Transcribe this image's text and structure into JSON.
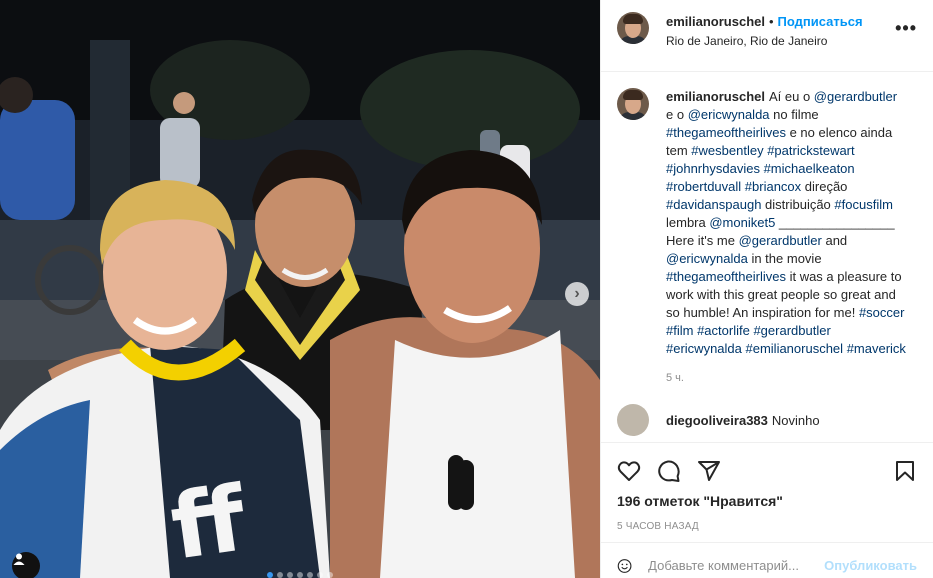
{
  "post": {
    "username": "emilianoruschel",
    "bullet": "•",
    "follow_label": "Подписаться",
    "location": "Rio de Janeiro, Rio de Janeiro",
    "more_label": "•••"
  },
  "caption": {
    "username": "emilianoruschel",
    "parts": [
      {
        "text": "Aí eu o ",
        "link": false
      },
      {
        "text": "@gerardbutler",
        "link": true
      },
      {
        "text": " e o ",
        "link": false
      },
      {
        "text": "@ericwynalda",
        "link": true
      },
      {
        "text": " no filme ",
        "link": false
      },
      {
        "text": "#thegameoftheirlives",
        "link": true
      },
      {
        "text": " e no elenco ainda tem ",
        "link": false
      },
      {
        "text": "#wesbentley",
        "link": true
      },
      {
        "text": " ",
        "link": false
      },
      {
        "text": "#patrickstewart",
        "link": true
      },
      {
        "text": " ",
        "link": false
      },
      {
        "text": "#johnrhysdavies",
        "link": true
      },
      {
        "text": " ",
        "link": false
      },
      {
        "text": "#michaelkeaton",
        "link": true
      },
      {
        "text": " ",
        "link": false
      },
      {
        "text": "#robertduvall",
        "link": true
      },
      {
        "text": " ",
        "link": false
      },
      {
        "text": "#briancox",
        "link": true
      },
      {
        "text": " direção ",
        "link": false
      },
      {
        "text": "#davidanspaugh",
        "link": true
      },
      {
        "text": " distribuição ",
        "link": false
      },
      {
        "text": "#focusfilm",
        "link": true
      },
      {
        "text": " lembra ",
        "link": false
      },
      {
        "text": "@moniket5",
        "link": true
      },
      {
        "text": " ________________ Here it's me ",
        "link": false
      },
      {
        "text": "@gerardbutler",
        "link": true
      },
      {
        "text": " and ",
        "link": false
      },
      {
        "text": "@ericwynalda",
        "link": true
      },
      {
        "text": " in the movie ",
        "link": false
      },
      {
        "text": "#thegameoftheirlives",
        "link": true
      },
      {
        "text": " it was a pleasure to work with this great people so great and so humble! An inspiration for me! ",
        "link": false
      },
      {
        "text": "#soccer",
        "link": true
      },
      {
        "text": " ",
        "link": false
      },
      {
        "text": "#film",
        "link": true
      },
      {
        "text": " ",
        "link": false
      },
      {
        "text": "#actorlife",
        "link": true
      },
      {
        "text": " ",
        "link": false
      },
      {
        "text": "#gerardbutler",
        "link": true
      },
      {
        "text": " ",
        "link": false
      },
      {
        "text": "#ericwynalda",
        "link": true
      },
      {
        "text": " ",
        "link": false
      },
      {
        "text": "#emilianoruschel",
        "link": true
      },
      {
        "text": " ",
        "link": false
      },
      {
        "text": "#maverick",
        "link": true
      }
    ],
    "time": "5 ч."
  },
  "next_comment": {
    "username": "diegooliveira383",
    "text": "Novinho"
  },
  "actions": {
    "likes": "196 отметок \"Нравится\"",
    "posted": "5 часов назад"
  },
  "add_comment": {
    "placeholder": "Добавьте комментарий...",
    "publish_label": "Опубликовать"
  },
  "carousel": {
    "slides": 7,
    "active_index": 0
  },
  "colors": {
    "link": "#00376b",
    "follow": "#0095f6",
    "publish_disabled": "#b2dffc",
    "muted": "#8e8e8e"
  },
  "icons": [
    "heart-icon",
    "comment-icon",
    "share-icon",
    "bookmark-icon",
    "emoji-icon",
    "user-tag-icon",
    "chevron-right-icon",
    "more-icon"
  ]
}
